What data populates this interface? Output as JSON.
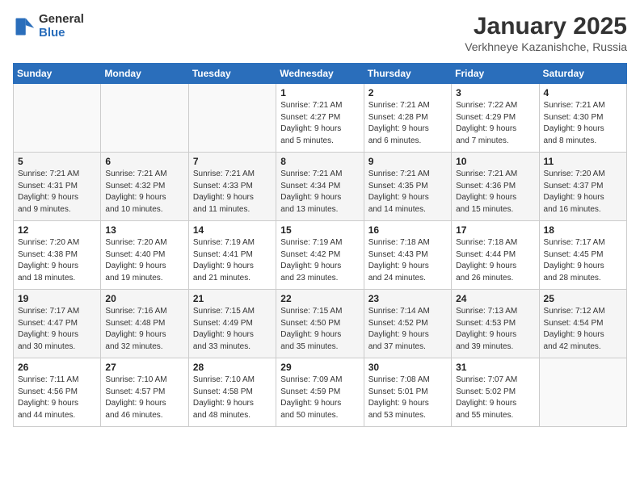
{
  "logo": {
    "general": "General",
    "blue": "Blue"
  },
  "title": "January 2025",
  "location": "Verkhneye Kazanishche, Russia",
  "days_of_week": [
    "Sunday",
    "Monday",
    "Tuesday",
    "Wednesday",
    "Thursday",
    "Friday",
    "Saturday"
  ],
  "weeks": [
    [
      {
        "day": "",
        "info": ""
      },
      {
        "day": "",
        "info": ""
      },
      {
        "day": "",
        "info": ""
      },
      {
        "day": "1",
        "info": "Sunrise: 7:21 AM\nSunset: 4:27 PM\nDaylight: 9 hours\nand 5 minutes."
      },
      {
        "day": "2",
        "info": "Sunrise: 7:21 AM\nSunset: 4:28 PM\nDaylight: 9 hours\nand 6 minutes."
      },
      {
        "day": "3",
        "info": "Sunrise: 7:22 AM\nSunset: 4:29 PM\nDaylight: 9 hours\nand 7 minutes."
      },
      {
        "day": "4",
        "info": "Sunrise: 7:21 AM\nSunset: 4:30 PM\nDaylight: 9 hours\nand 8 minutes."
      }
    ],
    [
      {
        "day": "5",
        "info": "Sunrise: 7:21 AM\nSunset: 4:31 PM\nDaylight: 9 hours\nand 9 minutes."
      },
      {
        "day": "6",
        "info": "Sunrise: 7:21 AM\nSunset: 4:32 PM\nDaylight: 9 hours\nand 10 minutes."
      },
      {
        "day": "7",
        "info": "Sunrise: 7:21 AM\nSunset: 4:33 PM\nDaylight: 9 hours\nand 11 minutes."
      },
      {
        "day": "8",
        "info": "Sunrise: 7:21 AM\nSunset: 4:34 PM\nDaylight: 9 hours\nand 13 minutes."
      },
      {
        "day": "9",
        "info": "Sunrise: 7:21 AM\nSunset: 4:35 PM\nDaylight: 9 hours\nand 14 minutes."
      },
      {
        "day": "10",
        "info": "Sunrise: 7:21 AM\nSunset: 4:36 PM\nDaylight: 9 hours\nand 15 minutes."
      },
      {
        "day": "11",
        "info": "Sunrise: 7:20 AM\nSunset: 4:37 PM\nDaylight: 9 hours\nand 16 minutes."
      }
    ],
    [
      {
        "day": "12",
        "info": "Sunrise: 7:20 AM\nSunset: 4:38 PM\nDaylight: 9 hours\nand 18 minutes."
      },
      {
        "day": "13",
        "info": "Sunrise: 7:20 AM\nSunset: 4:40 PM\nDaylight: 9 hours\nand 19 minutes."
      },
      {
        "day": "14",
        "info": "Sunrise: 7:19 AM\nSunset: 4:41 PM\nDaylight: 9 hours\nand 21 minutes."
      },
      {
        "day": "15",
        "info": "Sunrise: 7:19 AM\nSunset: 4:42 PM\nDaylight: 9 hours\nand 23 minutes."
      },
      {
        "day": "16",
        "info": "Sunrise: 7:18 AM\nSunset: 4:43 PM\nDaylight: 9 hours\nand 24 minutes."
      },
      {
        "day": "17",
        "info": "Sunrise: 7:18 AM\nSunset: 4:44 PM\nDaylight: 9 hours\nand 26 minutes."
      },
      {
        "day": "18",
        "info": "Sunrise: 7:17 AM\nSunset: 4:45 PM\nDaylight: 9 hours\nand 28 minutes."
      }
    ],
    [
      {
        "day": "19",
        "info": "Sunrise: 7:17 AM\nSunset: 4:47 PM\nDaylight: 9 hours\nand 30 minutes."
      },
      {
        "day": "20",
        "info": "Sunrise: 7:16 AM\nSunset: 4:48 PM\nDaylight: 9 hours\nand 32 minutes."
      },
      {
        "day": "21",
        "info": "Sunrise: 7:15 AM\nSunset: 4:49 PM\nDaylight: 9 hours\nand 33 minutes."
      },
      {
        "day": "22",
        "info": "Sunrise: 7:15 AM\nSunset: 4:50 PM\nDaylight: 9 hours\nand 35 minutes."
      },
      {
        "day": "23",
        "info": "Sunrise: 7:14 AM\nSunset: 4:52 PM\nDaylight: 9 hours\nand 37 minutes."
      },
      {
        "day": "24",
        "info": "Sunrise: 7:13 AM\nSunset: 4:53 PM\nDaylight: 9 hours\nand 39 minutes."
      },
      {
        "day": "25",
        "info": "Sunrise: 7:12 AM\nSunset: 4:54 PM\nDaylight: 9 hours\nand 42 minutes."
      }
    ],
    [
      {
        "day": "26",
        "info": "Sunrise: 7:11 AM\nSunset: 4:56 PM\nDaylight: 9 hours\nand 44 minutes."
      },
      {
        "day": "27",
        "info": "Sunrise: 7:10 AM\nSunset: 4:57 PM\nDaylight: 9 hours\nand 46 minutes."
      },
      {
        "day": "28",
        "info": "Sunrise: 7:10 AM\nSunset: 4:58 PM\nDaylight: 9 hours\nand 48 minutes."
      },
      {
        "day": "29",
        "info": "Sunrise: 7:09 AM\nSunset: 4:59 PM\nDaylight: 9 hours\nand 50 minutes."
      },
      {
        "day": "30",
        "info": "Sunrise: 7:08 AM\nSunset: 5:01 PM\nDaylight: 9 hours\nand 53 minutes."
      },
      {
        "day": "31",
        "info": "Sunrise: 7:07 AM\nSunset: 5:02 PM\nDaylight: 9 hours\nand 55 minutes."
      },
      {
        "day": "",
        "info": ""
      }
    ]
  ]
}
